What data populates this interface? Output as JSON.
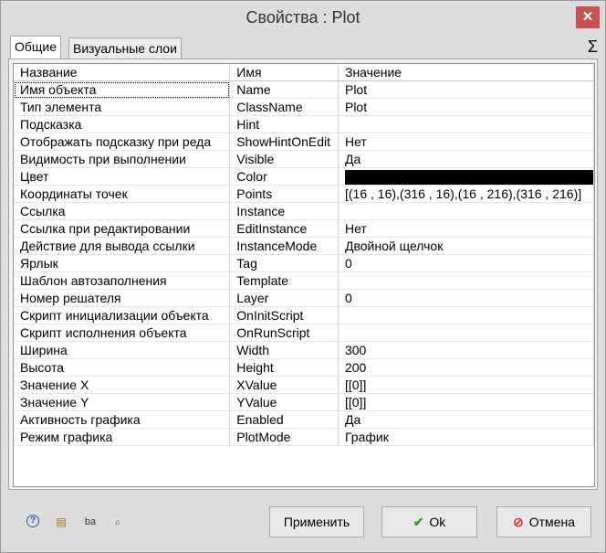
{
  "window": {
    "title": "Свойства :   Plot"
  },
  "tabs": [
    {
      "label": "Общие"
    },
    {
      "label": "Визуальные слои"
    }
  ],
  "sigma": "Σ",
  "grid": {
    "headers": {
      "name": "Название",
      "id": "Имя",
      "value": "Значение"
    },
    "rows": [
      {
        "name": "Имя объекта",
        "id": "Name",
        "value": "Plot"
      },
      {
        "name": "Тип элемента",
        "id": "ClassName",
        "value": "Plot"
      },
      {
        "name": "Подсказка",
        "id": "Hint",
        "value": ""
      },
      {
        "name": "Отображать подсказку при реда",
        "id": "ShowHintOnEdit",
        "value": "Нет"
      },
      {
        "name": "Видимость при выполнении",
        "id": "Visible",
        "value": "Да"
      },
      {
        "name": "Цвет",
        "id": "Color",
        "value": "",
        "swatch": "#000000"
      },
      {
        "name": "Координаты точек",
        "id": "Points",
        "value": "[(16 , 16),(316 , 16),(16 , 216),(316 , 216)]"
      },
      {
        "name": "Ссылка",
        "id": "Instance",
        "value": ""
      },
      {
        "name": "Ссылка при редактировании",
        "id": "EditInstance",
        "value": "Нет"
      },
      {
        "name": "Действие для вывода ссылки",
        "id": "InstanceMode",
        "value": "Двойной щелчок"
      },
      {
        "name": "Ярлык",
        "id": "Tag",
        "value": "0"
      },
      {
        "name": "Шаблон автозаполнения",
        "id": "Template",
        "value": ""
      },
      {
        "name": "Номер решателя",
        "id": "Layer",
        "value": "0"
      },
      {
        "name": "Скрипт инициализации объекта",
        "id": "OnInitScript",
        "value": ""
      },
      {
        "name": "Скрипт исполнения объекта",
        "id": "OnRunScript",
        "value": ""
      },
      {
        "name": "Ширина",
        "id": "Width",
        "value": "300"
      },
      {
        "name": "Высота",
        "id": "Height",
        "value": "200"
      },
      {
        "name": "Значение X",
        "id": "XValue",
        "value": "[[0]]"
      },
      {
        "name": "Значение Y",
        "id": "YValue",
        "value": "[[0]]"
      },
      {
        "name": "Активность графика",
        "id": "Enabled",
        "value": "Да"
      },
      {
        "name": "Режим графика",
        "id": "PlotMode",
        "value": "График"
      }
    ]
  },
  "footer": {
    "icons": [
      "help-icon",
      "properties-icon",
      "rename-icon",
      "search-icon"
    ],
    "apply_label": "Применить",
    "ok_label": "Ok",
    "cancel_label": "Отмена"
  }
}
